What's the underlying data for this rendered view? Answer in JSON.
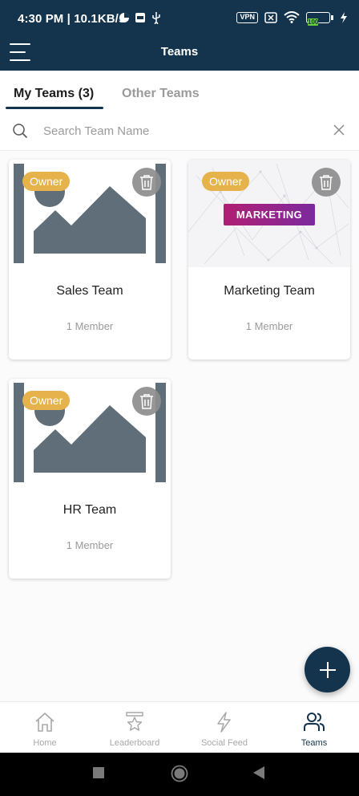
{
  "status_bar": {
    "time": "4:30 PM | 10.1KB/s",
    "vpn": "VPN",
    "battery": "100"
  },
  "header": {
    "title": "Teams"
  },
  "tabs": [
    {
      "label": "My Teams (3)",
      "active": true
    },
    {
      "label": "Other Teams",
      "active": false
    }
  ],
  "search": {
    "placeholder": "Search Team Name",
    "value": ""
  },
  "teams": [
    {
      "name": "Sales Team",
      "members": "1 Member",
      "badge": "Owner",
      "image": "placeholder-image-icon"
    },
    {
      "name": "Marketing Team",
      "members": "1 Member",
      "badge": "Owner",
      "image_text": "MARKETING"
    },
    {
      "name": "HR Team",
      "members": "1 Member",
      "badge": "Owner",
      "image": "placeholder-image-icon"
    }
  ],
  "bottom_nav": [
    {
      "label": "Home",
      "icon": "home-icon",
      "active": false
    },
    {
      "label": "Leaderboard",
      "icon": "leaderboard-icon",
      "active": false
    },
    {
      "label": "Social Feed",
      "icon": "lightning-icon",
      "active": false
    },
    {
      "label": "Teams",
      "icon": "people-icon",
      "active": true
    }
  ],
  "colors": {
    "primary": "#14344e",
    "owner_badge": "#e5b24c",
    "placeholder_gray": "#5f6e78"
  }
}
